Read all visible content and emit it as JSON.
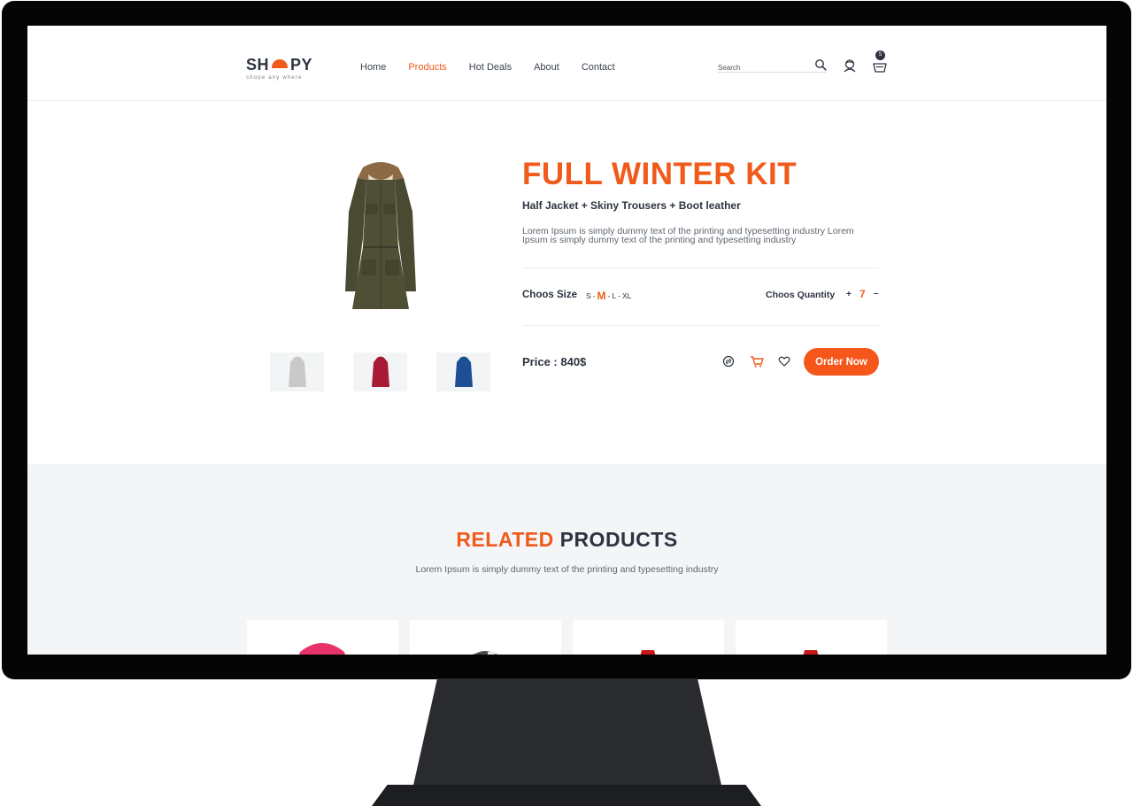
{
  "brand": {
    "logo_left": "SH",
    "logo_right": "PY",
    "tagline": "shope any where"
  },
  "nav": {
    "items": [
      {
        "label": "Home"
      },
      {
        "label": "Products",
        "active": true
      },
      {
        "label": "Hot Deals"
      },
      {
        "label": "About"
      },
      {
        "label": "Contact"
      }
    ]
  },
  "search": {
    "placeholder": "Search"
  },
  "cart": {
    "count": "5"
  },
  "product": {
    "title": "FULL WINTER KIT",
    "subtitle": "Half Jacket + Skiny Trousers + Boot leather",
    "description": "Lorem Ipsum is simply dummy text of the printing and typesetting industry Lorem Ipsum is simply dummy text of the printing and typesetting industry",
    "size_label": "Choos Size",
    "sizes": [
      "S",
      "M",
      "L",
      "XL"
    ],
    "selected_size": "M",
    "quantity_label": "Choos Quantity",
    "quantity_plus": "+",
    "quantity": "7",
    "quantity_minus": "–",
    "price_label": "Price : 840$",
    "order_button": "Order Now",
    "thumbnails": [
      {
        "color": "#c9c9c9"
      },
      {
        "color": "#a81a35"
      },
      {
        "color": "#1d4f94"
      }
    ],
    "main_image_color": "#4a4a33"
  },
  "related": {
    "title_accent": "RELATED",
    "title_rest": "PRODUCTS",
    "subtitle": "Lorem Ipsum is simply dummy text of the printing and typesetting industry",
    "cards": [
      {
        "color": "#e8336a"
      },
      {
        "color": "#6f7073"
      },
      {
        "color": "#e0201f"
      },
      {
        "color": "#e0201f"
      }
    ]
  },
  "colors": {
    "accent": "#f05a1a",
    "dark": "#2c3440"
  }
}
